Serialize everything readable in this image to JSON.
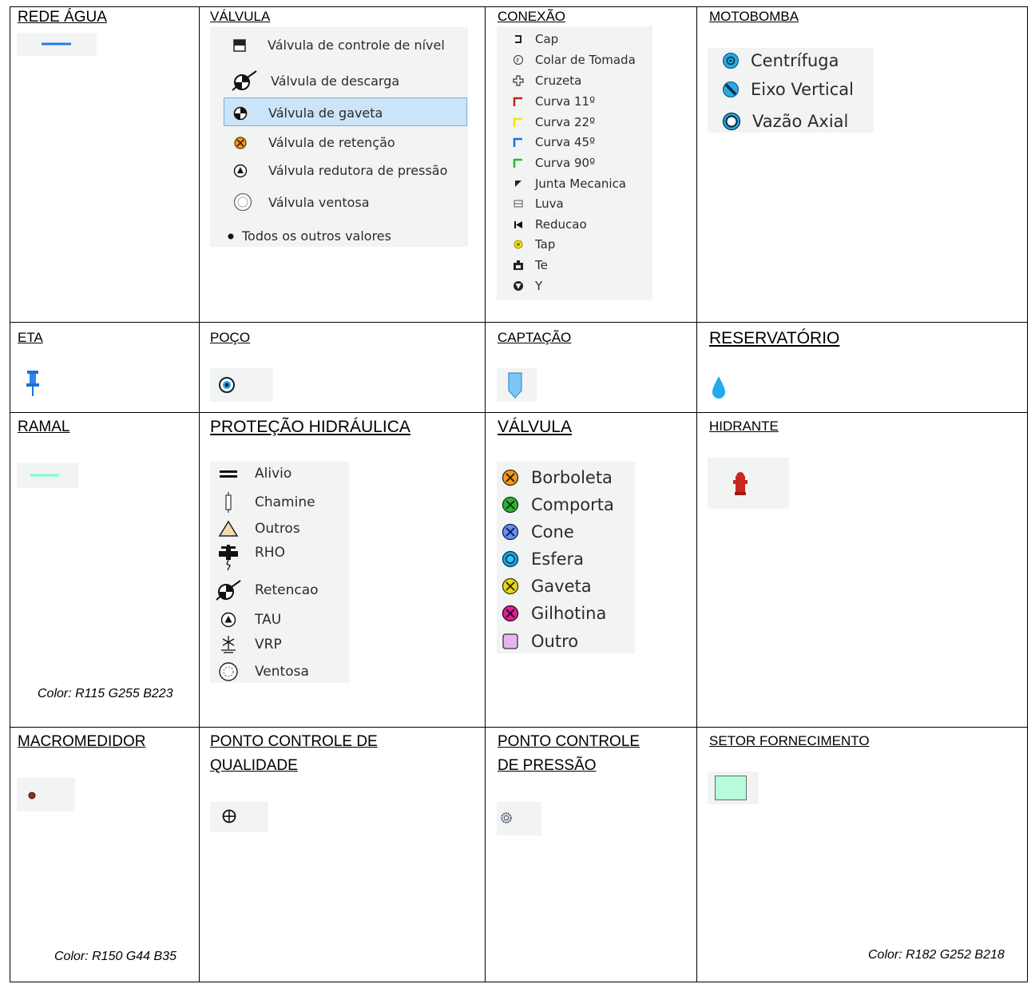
{
  "cells": {
    "rede_agua": {
      "title": "REDE ÁGUA"
    },
    "valvula_top": {
      "title": "VÁLVULA",
      "items": [
        "Válvula de controle de nível",
        "Válvula de descarga",
        "Válvula de gaveta",
        "Válvula de retenção",
        "Válvula redutora de pressão",
        "Válvula ventosa",
        "Todos os outros valores"
      ],
      "selected": "Válvula de gaveta"
    },
    "conexao": {
      "title": "CONEXÃO",
      "items": [
        "Cap",
        "Colar de Tomada",
        "Cruzeta",
        "Curva 11º",
        "Curva 22º",
        "Curva 45º",
        "Curva 90º",
        "Junta Mecanica",
        "Luva",
        "Reducao",
        "Tap",
        "Te",
        "Y"
      ]
    },
    "motobomba": {
      "title": "MOTOBOMBA",
      "items": [
        "Centrífuga",
        "Eixo Vertical",
        "Vazão Axial"
      ]
    },
    "eta": {
      "title": "ETA"
    },
    "poco": {
      "title": "POÇO"
    },
    "captacao": {
      "title": "CAPTAÇÃO"
    },
    "reservatorio": {
      "title": "RESERVATÓRIO"
    },
    "ramal": {
      "title": "RAMAL",
      "note": "Color: R115 G255 B223"
    },
    "protecao": {
      "title": "PROTEÇÃO HIDRÁULICA",
      "items": [
        "Alivio",
        "Chamine",
        "Outros",
        "RHO",
        "Retencao",
        "TAU",
        "VRP",
        "Ventosa"
      ]
    },
    "valvula_mid": {
      "title": "VÁLVULA",
      "items": [
        "Borboleta",
        "Comporta",
        "Cone",
        "Esfera",
        "Gaveta",
        "Gilhotina",
        "Outro"
      ]
    },
    "hidrante": {
      "title": "HIDRANTE"
    },
    "macromedidor": {
      "title": "MACROMEDIDOR",
      "note": "Color: R150 G44 B35"
    },
    "ponto_qualidade": {
      "title_line1": "PONTO CONTROLE DE",
      "title_line2": "QUALIDADE"
    },
    "ponto_pressao": {
      "title_line1": "PONTO CONTROLE",
      "title_line2": "DE PRESSÃO"
    },
    "setor": {
      "title": "SETOR FORNECIMENTO",
      "note": "Color: R182 G252 B218"
    }
  },
  "colors": {
    "rede_agua_line": "#1e7fe6",
    "ramal_line": "#73ffdf",
    "macromedidor": "#962c23",
    "setor_fill": "#b6fcda",
    "selection": "#cce4f7",
    "selection_border": "#7aaed9"
  },
  "icons": {
    "eta": "pushpin-icon",
    "poco": "target-circle-icon",
    "captacao": "shield-icon",
    "reservatorio": "water-drop-icon",
    "hidrante": "fire-hydrant-icon",
    "ponto_qualidade": "crosshair-circle-icon",
    "ponto_pressao": "gear-circle-icon"
  }
}
